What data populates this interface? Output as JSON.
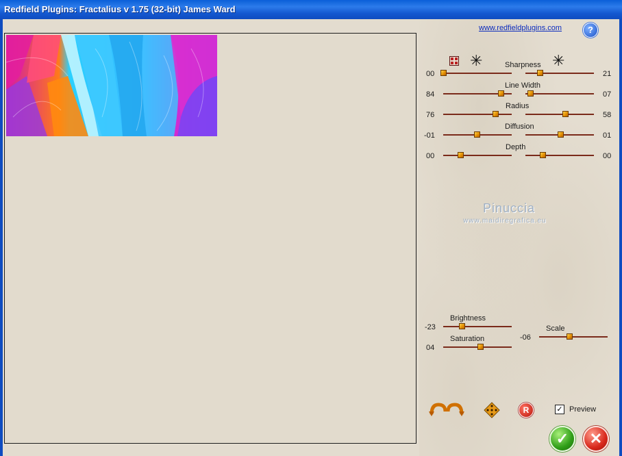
{
  "window": {
    "title": "Redfield Plugins: Fractalius v 1.75 (32-bit)   James Ward"
  },
  "header": {
    "link_text": "www.redfieldplugins.com",
    "help_symbol": "?"
  },
  "sharpness": {
    "label": "Sharpness",
    "left_value": "00",
    "right_value": "21",
    "left_level": 0.0,
    "right_level": 0.21
  },
  "line_width": {
    "label": "Line Width",
    "left_value": "84",
    "right_value": "07",
    "left_level": 0.84,
    "right_level": 0.07
  },
  "radius": {
    "label": "Radius",
    "left_value": "76",
    "right_value": "58",
    "left_level": 0.76,
    "right_level": 0.58
  },
  "diffusion": {
    "label": "Diffusion",
    "left_value": "-01",
    "right_value": "01",
    "left_level": 0.49,
    "right_level": 0.51
  },
  "depth": {
    "label": "Depth",
    "left_value": "00",
    "right_value": "00",
    "left_level": 0.25,
    "right_level": 0.25
  },
  "watermark": {
    "name": "Pinuccia",
    "url": "www.maidiregrafica.eu"
  },
  "brightness": {
    "label": "Brightness",
    "value": "-23",
    "level": 0.27
  },
  "saturation": {
    "label": "Saturation",
    "value": "04",
    "level": 0.54
  },
  "scale": {
    "label": "Scale",
    "value": "-06",
    "level": 0.44
  },
  "preview": {
    "label": "Preview",
    "checked": true,
    "check_mark": "✓"
  },
  "icons": {
    "grid": "grid-icon",
    "burst_left": "asterisk-burst-icon",
    "burst_right": "asterisk-burst-icon",
    "undo_redo": "undo-redo-arrows-icon",
    "random": "dice-icon",
    "reset": "reset-r-icon",
    "ok": "checkmark-icon",
    "cancel": "close-x-icon"
  },
  "buttons": {
    "ok_symbol": "✓",
    "cancel_symbol": "✕",
    "reset_symbol": "R",
    "burst_symbol": "✳"
  }
}
